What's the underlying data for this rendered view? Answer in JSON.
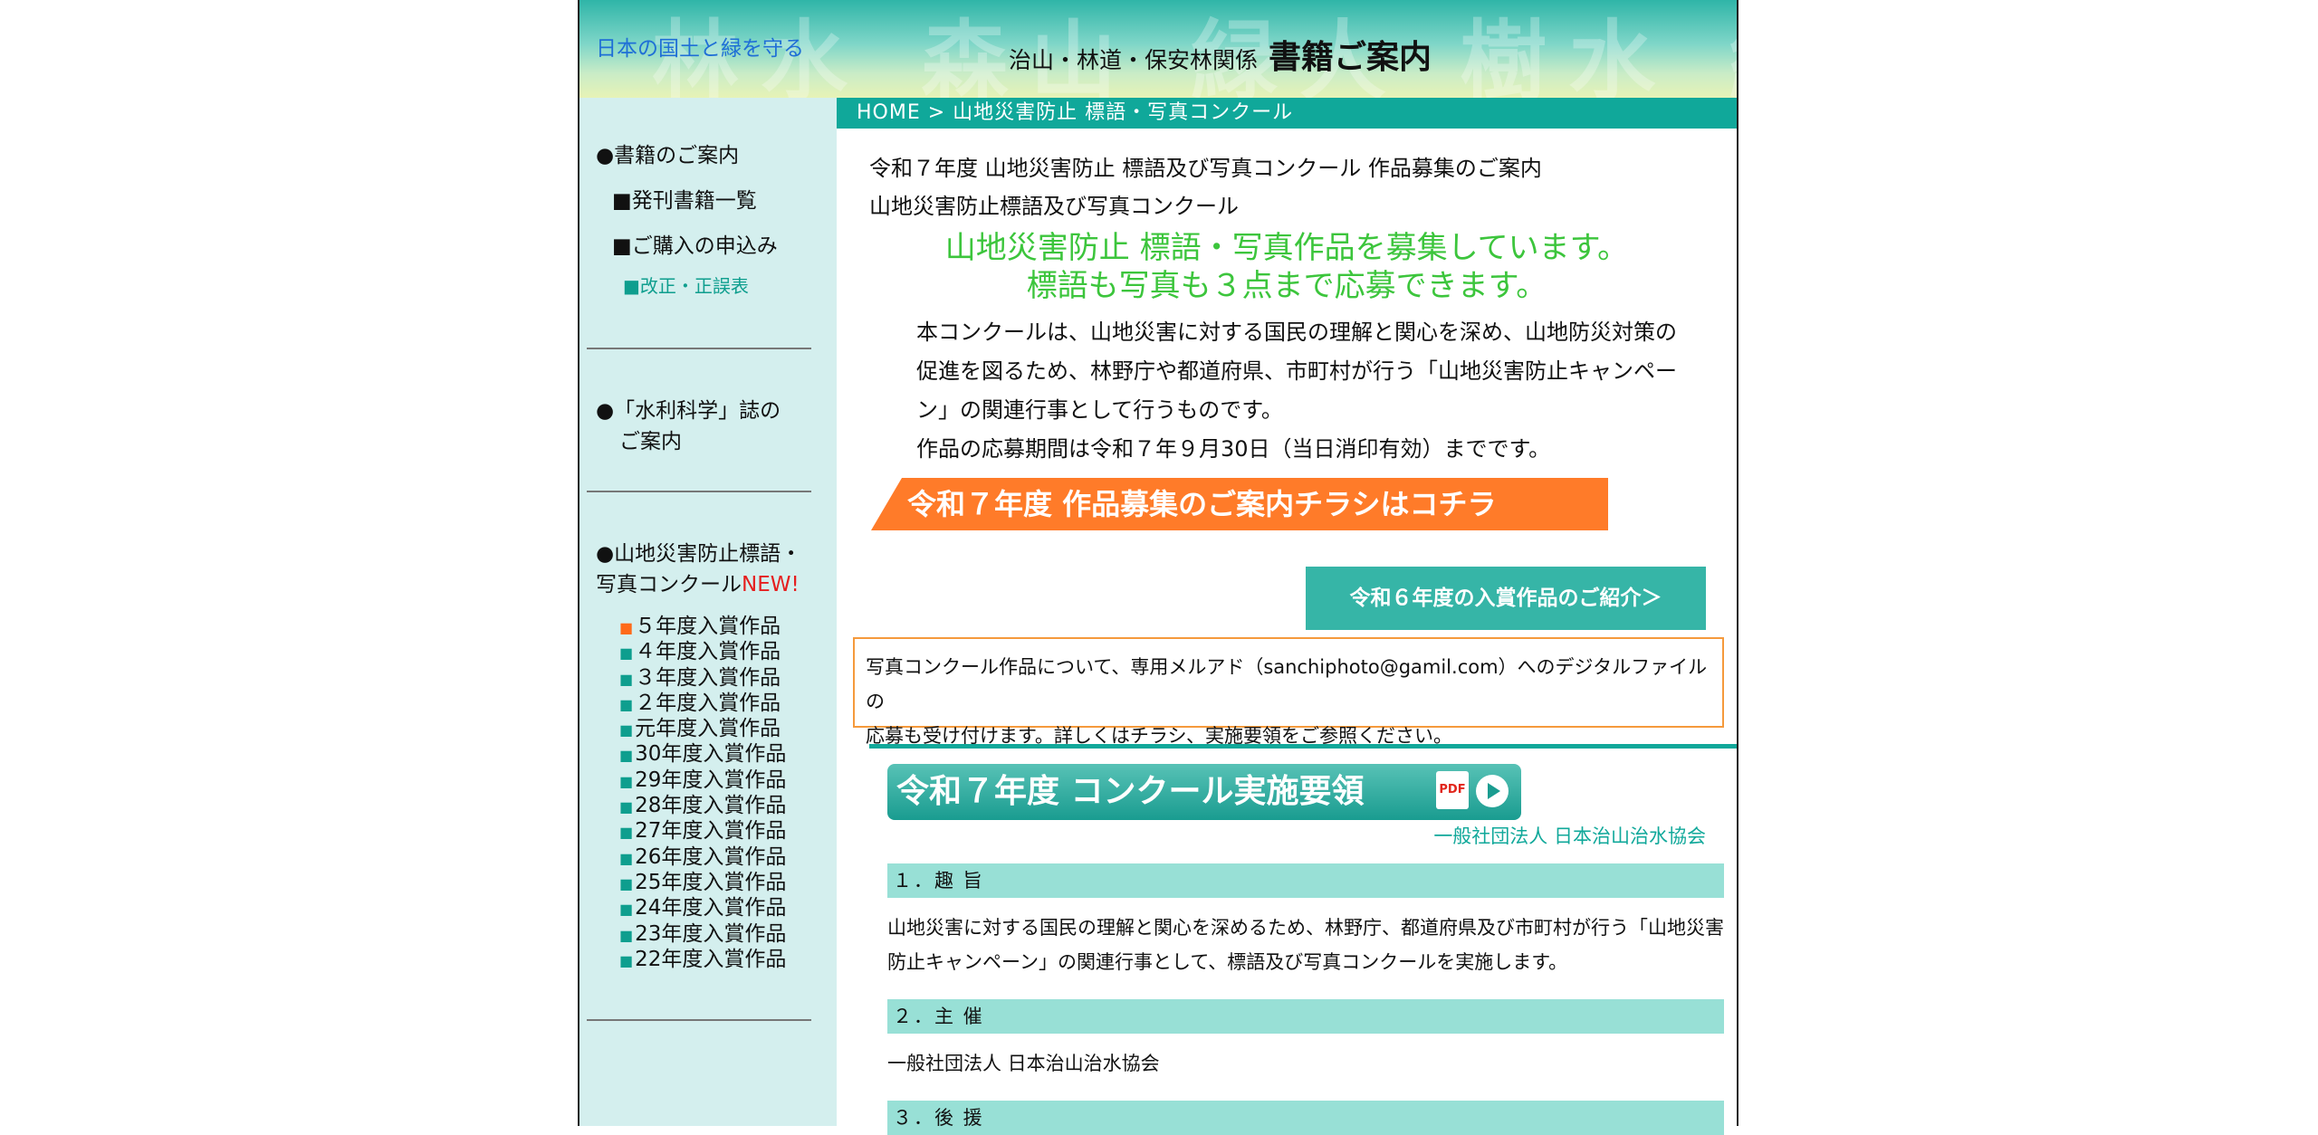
{
  "header": {
    "tagline": "日本の国土と緑を守る",
    "subtitle": "治山・林道・保安林関係",
    "title": "書籍ご案内",
    "bg_text": "林水 森山 緑人 樹水 緑林"
  },
  "sidebar": {
    "books_head": "●書籍のご案内",
    "publications": "■発刊書籍一覧",
    "purchase": "■ご購入の申込み",
    "errata": "■改正・正誤表",
    "journal_line1": "●「水利科学」誌の",
    "journal_line2": "ご案内",
    "contest_line1": "●山地災害防止標語・",
    "contest_line2": "写真コンクール",
    "new_label": "NEW!",
    "years": [
      "５年度入賞作品",
      "４年度入賞作品",
      "３年度入賞作品",
      "２年度入賞作品",
      "元年度入賞作品",
      "30年度入賞作品",
      "29年度入賞作品",
      "28年度入賞作品",
      "27年度入賞作品",
      "26年度入賞作品",
      "25年度入賞作品",
      "24年度入賞作品",
      "23年度入賞作品",
      "22年度入賞作品"
    ]
  },
  "breadcrumb": "HOME > 山地災害防止 標語・写真コンクール",
  "main": {
    "line1": "令和７年度 山地災害防止 標語及び写真コンクール 作品募集のご案内",
    "line2": "山地災害防止標語及び写真コンクール",
    "headline1": "山地災害防止 標語・写真作品を募集しています。",
    "headline2": "標語も写真も３点まで応募できます。",
    "para_line1": "本コンクールは、山地災害に対する国民の理解と関心を深め、山地防災対策の",
    "para_line2": "促進を図るため、林野庁や都道府県、市町村が行う「山地災害防止キャンペー",
    "para_line3": "ン」の関連行事として行うものです。",
    "para_line4": "作品の応募期間は令和７年９月30日（当日消印有効）までです。",
    "flyer_button": "令和７年度 作品募集のご案内チラシはコチラ",
    "prize_button": "令和６年度の入賞作品のご紹介＞",
    "notice_line1": "写真コンクール作品について、専用メルアド（sanchiphoto@gamil.com）へのデジタルファイルの",
    "notice_line2": "応募も受け付けます。詳しくはチラシ、実施要領をご参照ください。",
    "guide_banner": "令和７年度 コンクール実施要領",
    "pdf_label": "PDF",
    "org": "一般社団法人 日本治山治水協会",
    "sec1_head": "１．趣 旨",
    "sec1_line1": "山地災害に対する国民の理解と関心を深めるため、林野庁、都道府県及び市町村が行う「山地災害",
    "sec1_line2": "防止キャンペーン」の関連行事として、標語及び写真コンクールを実施します。",
    "sec2_head": "２．主 催",
    "sec2_body": "一般社団法人 日本治山治水協会",
    "sec3_head": "３．後 援"
  },
  "colors": {
    "teal": "#10a89a",
    "sidebar_bg": "#d4efee",
    "headline_green": "#3cc53c",
    "flyer_orange": "#ff7b29",
    "section_bg": "#98e0d6",
    "new_red": "#e51e1e"
  }
}
